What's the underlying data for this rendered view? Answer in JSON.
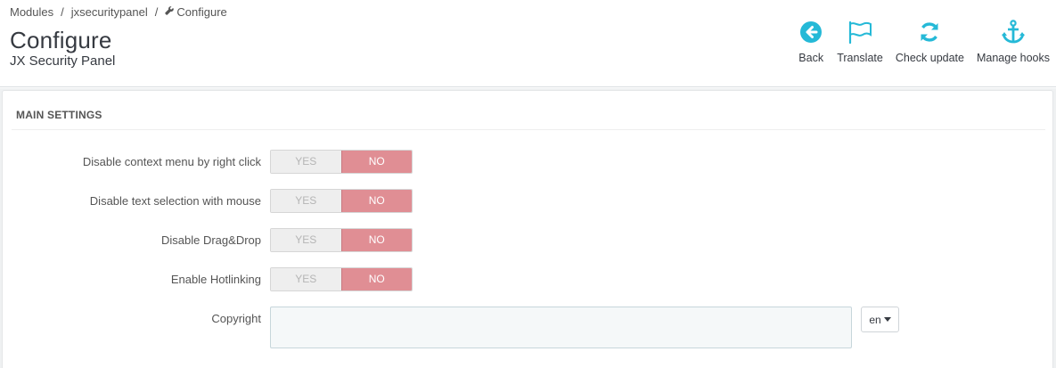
{
  "breadcrumb": {
    "items": [
      "Modules",
      "jxsecuritypanel",
      "Configure"
    ],
    "separator": "/"
  },
  "header": {
    "title": "Configure",
    "subtitle": "JX Security Panel"
  },
  "toolbar": {
    "buttons": [
      {
        "label": "Back",
        "icon": "arrow-circle-left-icon"
      },
      {
        "label": "Translate",
        "icon": "flag-icon"
      },
      {
        "label": "Check update",
        "icon": "refresh-icon"
      },
      {
        "label": "Manage hooks",
        "icon": "anchor-icon"
      }
    ],
    "icon_color": "#25b9d7"
  },
  "panel": {
    "heading": "MAIN SETTINGS",
    "fields": [
      {
        "label": "Disable context menu by right click",
        "yes": "YES",
        "no": "NO",
        "value": "NO"
      },
      {
        "label": "Disable text selection with mouse",
        "yes": "YES",
        "no": "NO",
        "value": "NO"
      },
      {
        "label": "Disable Drag&Drop",
        "yes": "YES",
        "no": "NO",
        "value": "NO"
      },
      {
        "label": "Enable Hotlinking",
        "yes": "YES",
        "no": "NO",
        "value": "NO"
      }
    ],
    "copyright": {
      "label": "Copyright",
      "value": "",
      "language": "en"
    }
  },
  "colors": {
    "switch_no_active": "#e08e94",
    "switch_inactive": "#eeeeee",
    "accent": "#25b9d7"
  }
}
